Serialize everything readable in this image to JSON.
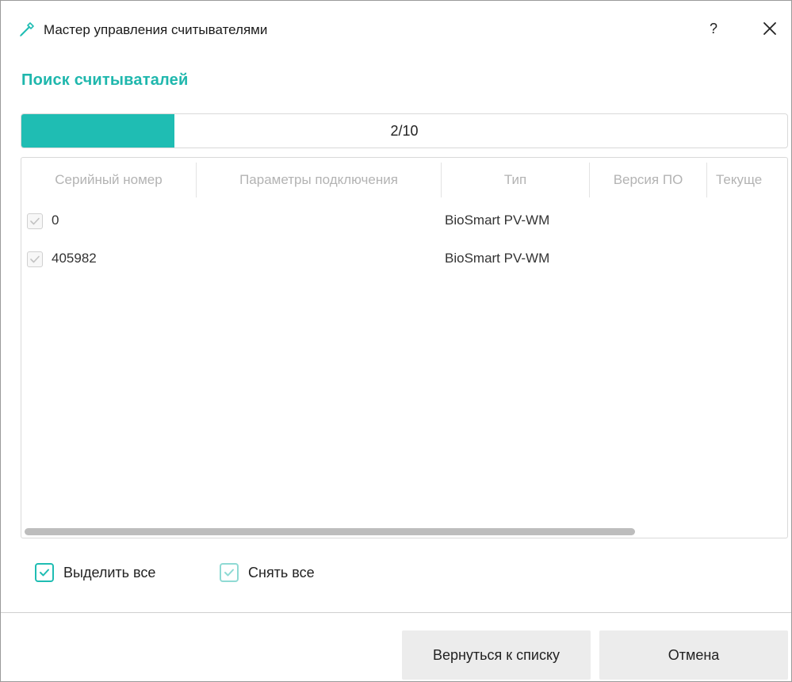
{
  "window": {
    "title": "Мастер управления считывателями",
    "help_label": "?",
    "accent_color": "#1fbdb3"
  },
  "section_title": "Поиск считываталей",
  "progress": {
    "text": "2/10",
    "value": 2,
    "max": 10
  },
  "table": {
    "columns": [
      "Серийный номер",
      "Параметры подключения",
      "Тип",
      "Версия ПО",
      "Текуще"
    ],
    "rows": [
      {
        "serial": "0",
        "type": "BioSmart PV-WM",
        "checked": true
      },
      {
        "serial": "405982",
        "type": "BioSmart PV-WM",
        "checked": true
      }
    ]
  },
  "controls": {
    "select_all": "Выделить все",
    "deselect_all": "Снять все"
  },
  "buttons": {
    "back": "Вернуться к списку",
    "cancel": "Отмена"
  },
  "icons": {
    "app": "wand-icon",
    "close": "close-icon",
    "check": "check-icon"
  }
}
